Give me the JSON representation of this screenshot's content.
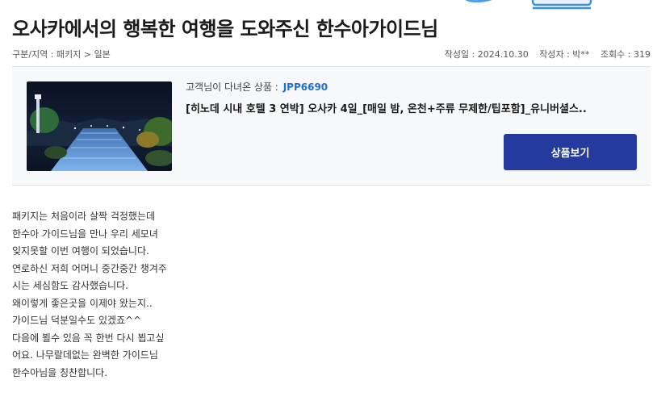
{
  "page": {
    "title": "오사카에서의 행복한 여행을 도와주신 한수아가이드님"
  },
  "meta": {
    "breadcrumb": "구분/지역 : 패키지 > 일본",
    "date_label": "작성일 : 2024.10.30",
    "author_label": "작성자 : 박**",
    "views_label": "조회수 : 319"
  },
  "product": {
    "code_label": "고객님이 다녀온 상품 :",
    "code": "JPP6690",
    "name": "[히노데 시내 호텔 3 연박] 오사카 4일_[매일 밤, 온천+주류 무제한/팁포함]_유니버셜스..",
    "button_label": "상품보기",
    "thumb_icon": "night-garden-photo"
  },
  "review": {
    "lines": [
      "패키지는 처음이라 살짝 걱정했는데",
      "한수아 가이드님을  만나 우리 세모녀",
      "잊지못할   이번 여행이 되었습니다.",
      "연로하신 저희 어머니 중간중간 챙겨주",
      "시는 세심함도 감사했습니다.",
      "왜이렇게 좋은곳을 이제야 왔는지..",
      "가이드님 덕분일수도 있겠죠^^",
      "다음에  뵐수 있음 꼭 한번 다시 뵙고싶",
      "어요. 나무랄데없는  완벽한 가이드님",
      "한수아님을  칭찬합니다."
    ]
  },
  "colors": {
    "accent": "#243a9c",
    "code": "#1e6ed8",
    "card_bg": "#f7f8fa"
  }
}
